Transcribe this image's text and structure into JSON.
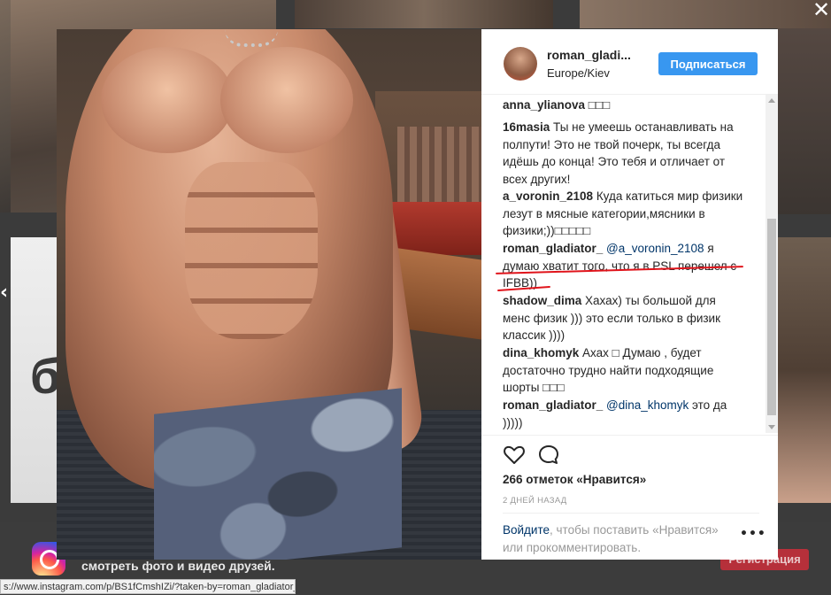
{
  "background": {
    "promo_text": "смотреть фото и видео друзей.",
    "register_label": "Регистрация",
    "big_letter": "б"
  },
  "status_url": "s://www.instagram.com/p/BS1fCmshIZi/?taken-by=roman_gladiator_",
  "close_glyph": "✕",
  "prev_glyph": "‹",
  "post": {
    "username": "roman_gladi...",
    "location": "Europe/Kiev",
    "follow_label": "Подписаться",
    "comments": [
      {
        "user": "anna_ylianova",
        "text": " □□□"
      },
      {
        "user": "16masia",
        "text": " Ты не умеешь останавливать на полпути! Это не твой почерк, ты всегда идёшь до конца! Это тебя и отличает от всех других!"
      },
      {
        "user": "a_voronin_2108",
        "text": " Куда катиться мир физики лезут в мясные категории,мясники в физики;))□□□□□"
      },
      {
        "user": "roman_gladiator_",
        "mention": " @a_voronin_2108",
        "text": " я думаю хватит того, что я в PSL перешел с IFBB))"
      },
      {
        "user": "shadow_dima",
        "text": " Хахах) ты большой для менс физик ))) это если только в физик классик ))))"
      },
      {
        "user": "dina_khomyk",
        "text": " Ахах □ Думаю , будет достаточно трудно найти подходящие шорты □□□"
      },
      {
        "user": "roman_gladiator_",
        "mention": " @dina_khomyk",
        "text": " это да )))))"
      }
    ],
    "likes_text": "266 отметок «Нравится»",
    "time_text": "2 ДНЕЙ НАЗАД",
    "login_link": "Войдите",
    "login_text": ", чтобы поставить «Нравится» или прокомментировать.",
    "more_glyph": "•••"
  },
  "colors": {
    "follow_button": "#3897f0",
    "register_button": "#b6303a",
    "annotation_underline": "#e0141b",
    "mention": "#003569"
  },
  "icons": [
    "heart-icon",
    "comment-icon",
    "instagram-logo-icon",
    "close-icon",
    "prev-arrow-icon"
  ]
}
